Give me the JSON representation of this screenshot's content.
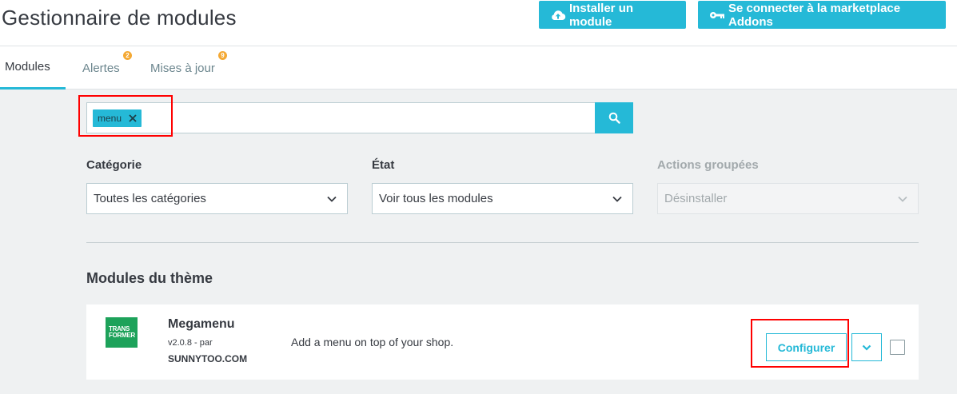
{
  "header": {
    "title": "Gestionnaire de modules",
    "install_button": "Installer un module",
    "install_icon": "cloud-upload-icon",
    "connect_button": "Se connecter à la marketplace Addons",
    "connect_icon": "key-icon"
  },
  "tabs": [
    {
      "label": "Modules",
      "active": true
    },
    {
      "label": "Alertes",
      "badge": "2"
    },
    {
      "label": "Mises à jour",
      "badge": "9"
    }
  ],
  "search": {
    "tag": "menu",
    "button_icon": "search-icon"
  },
  "filters": {
    "category": {
      "label": "Catégorie",
      "value": "Toutes les catégories"
    },
    "state": {
      "label": "État",
      "value": "Voir tous les modules"
    },
    "bulk_actions": {
      "label": "Actions groupées",
      "value": "Désinstaller",
      "disabled": true
    }
  },
  "section": {
    "title": "Modules du thème"
  },
  "module": {
    "logo_text_1": "TRANS",
    "logo_text_2": "FORMER",
    "name": "Megamenu",
    "version": "v2.0.8 - par",
    "author": "SUNNYTOO.COM",
    "description": "Add a menu on top of your shop.",
    "configure_label": "Configurer",
    "selected": false
  },
  "colors": {
    "accent": "#25b9d7",
    "badge": "#f4a934",
    "highlight": "#ff0000",
    "logo_green": "#1da25a"
  }
}
